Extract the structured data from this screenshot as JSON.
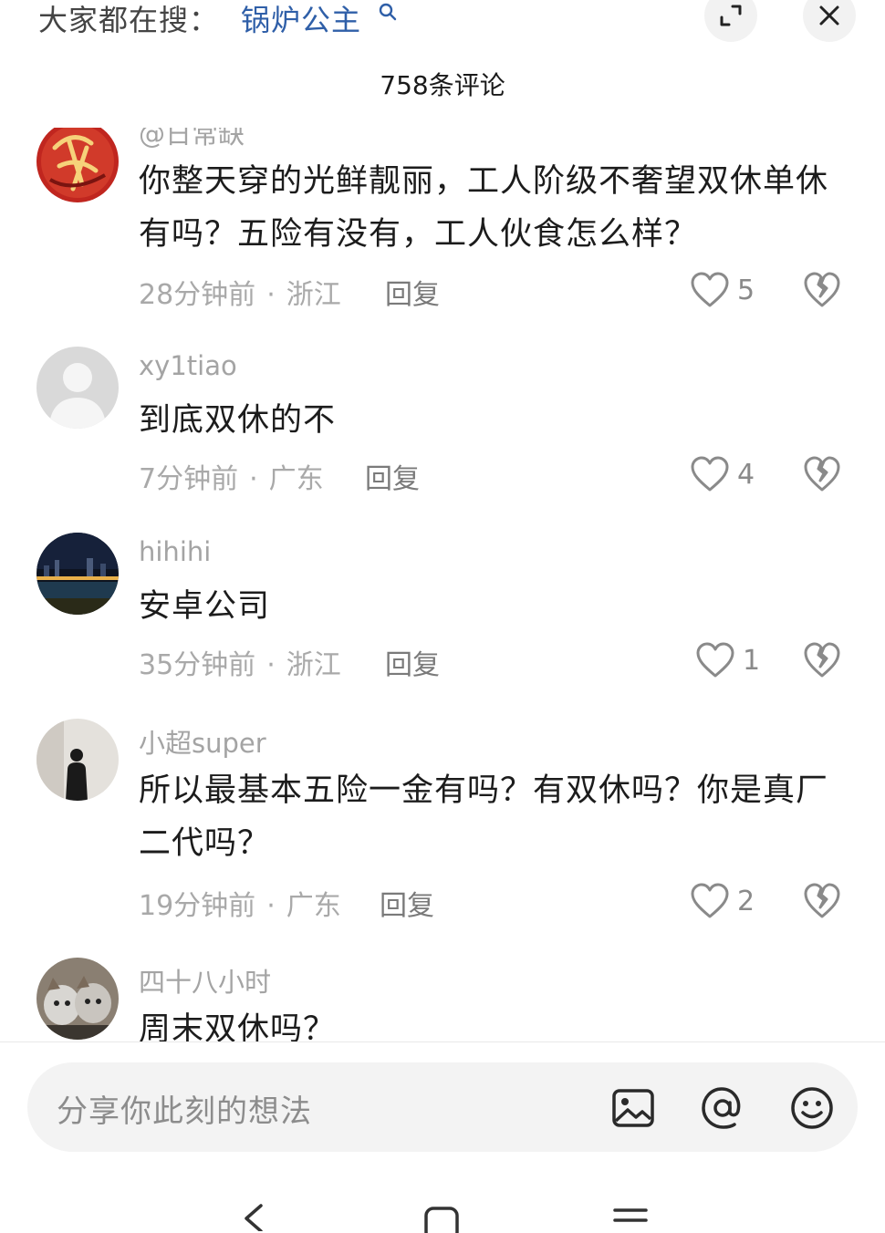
{
  "header": {
    "search_prefix": "大家都在搜：",
    "search_term": "锅炉公主",
    "comment_count": "758条评论"
  },
  "comments": [
    {
      "username": "@日常缺",
      "text": "你整天穿的光鲜靓丽，工人阶级不奢望双休单休有吗？五险有没有，工人伙食怎么样？",
      "time": "28分钟前",
      "location": "浙江",
      "reply": "回复",
      "likes": "5",
      "avatar": "red-calligraphy-avatar"
    },
    {
      "username": "xy1tiao",
      "text": "到底双休的不",
      "time": "7分钟前",
      "location": "广东",
      "reply": "回复",
      "likes": "4",
      "avatar": "default-avatar"
    },
    {
      "username": "hihihi",
      "text": "安卓公司",
      "time": "35分钟前",
      "location": "浙江",
      "reply": "回复",
      "likes": "1",
      "avatar": "night-city-avatar"
    },
    {
      "username": "小超super",
      "text": "所以最基本五险一金有吗？有双休吗？你是真厂二代吗？",
      "time": "19分钟前",
      "location": "广东",
      "reply": "回复",
      "likes": "2",
      "avatar": "silhouette-avatar"
    },
    {
      "username": "四十八小时",
      "text": "周末双休吗？",
      "avatar": "cats-avatar"
    }
  ],
  "input": {
    "placeholder": "分享你此刻的想法"
  },
  "colors": {
    "search_term": "#2f5fa8",
    "muted_text": "#a9a9a9",
    "body_text": "#1c1c1c",
    "input_bg": "#f3f3f3"
  }
}
